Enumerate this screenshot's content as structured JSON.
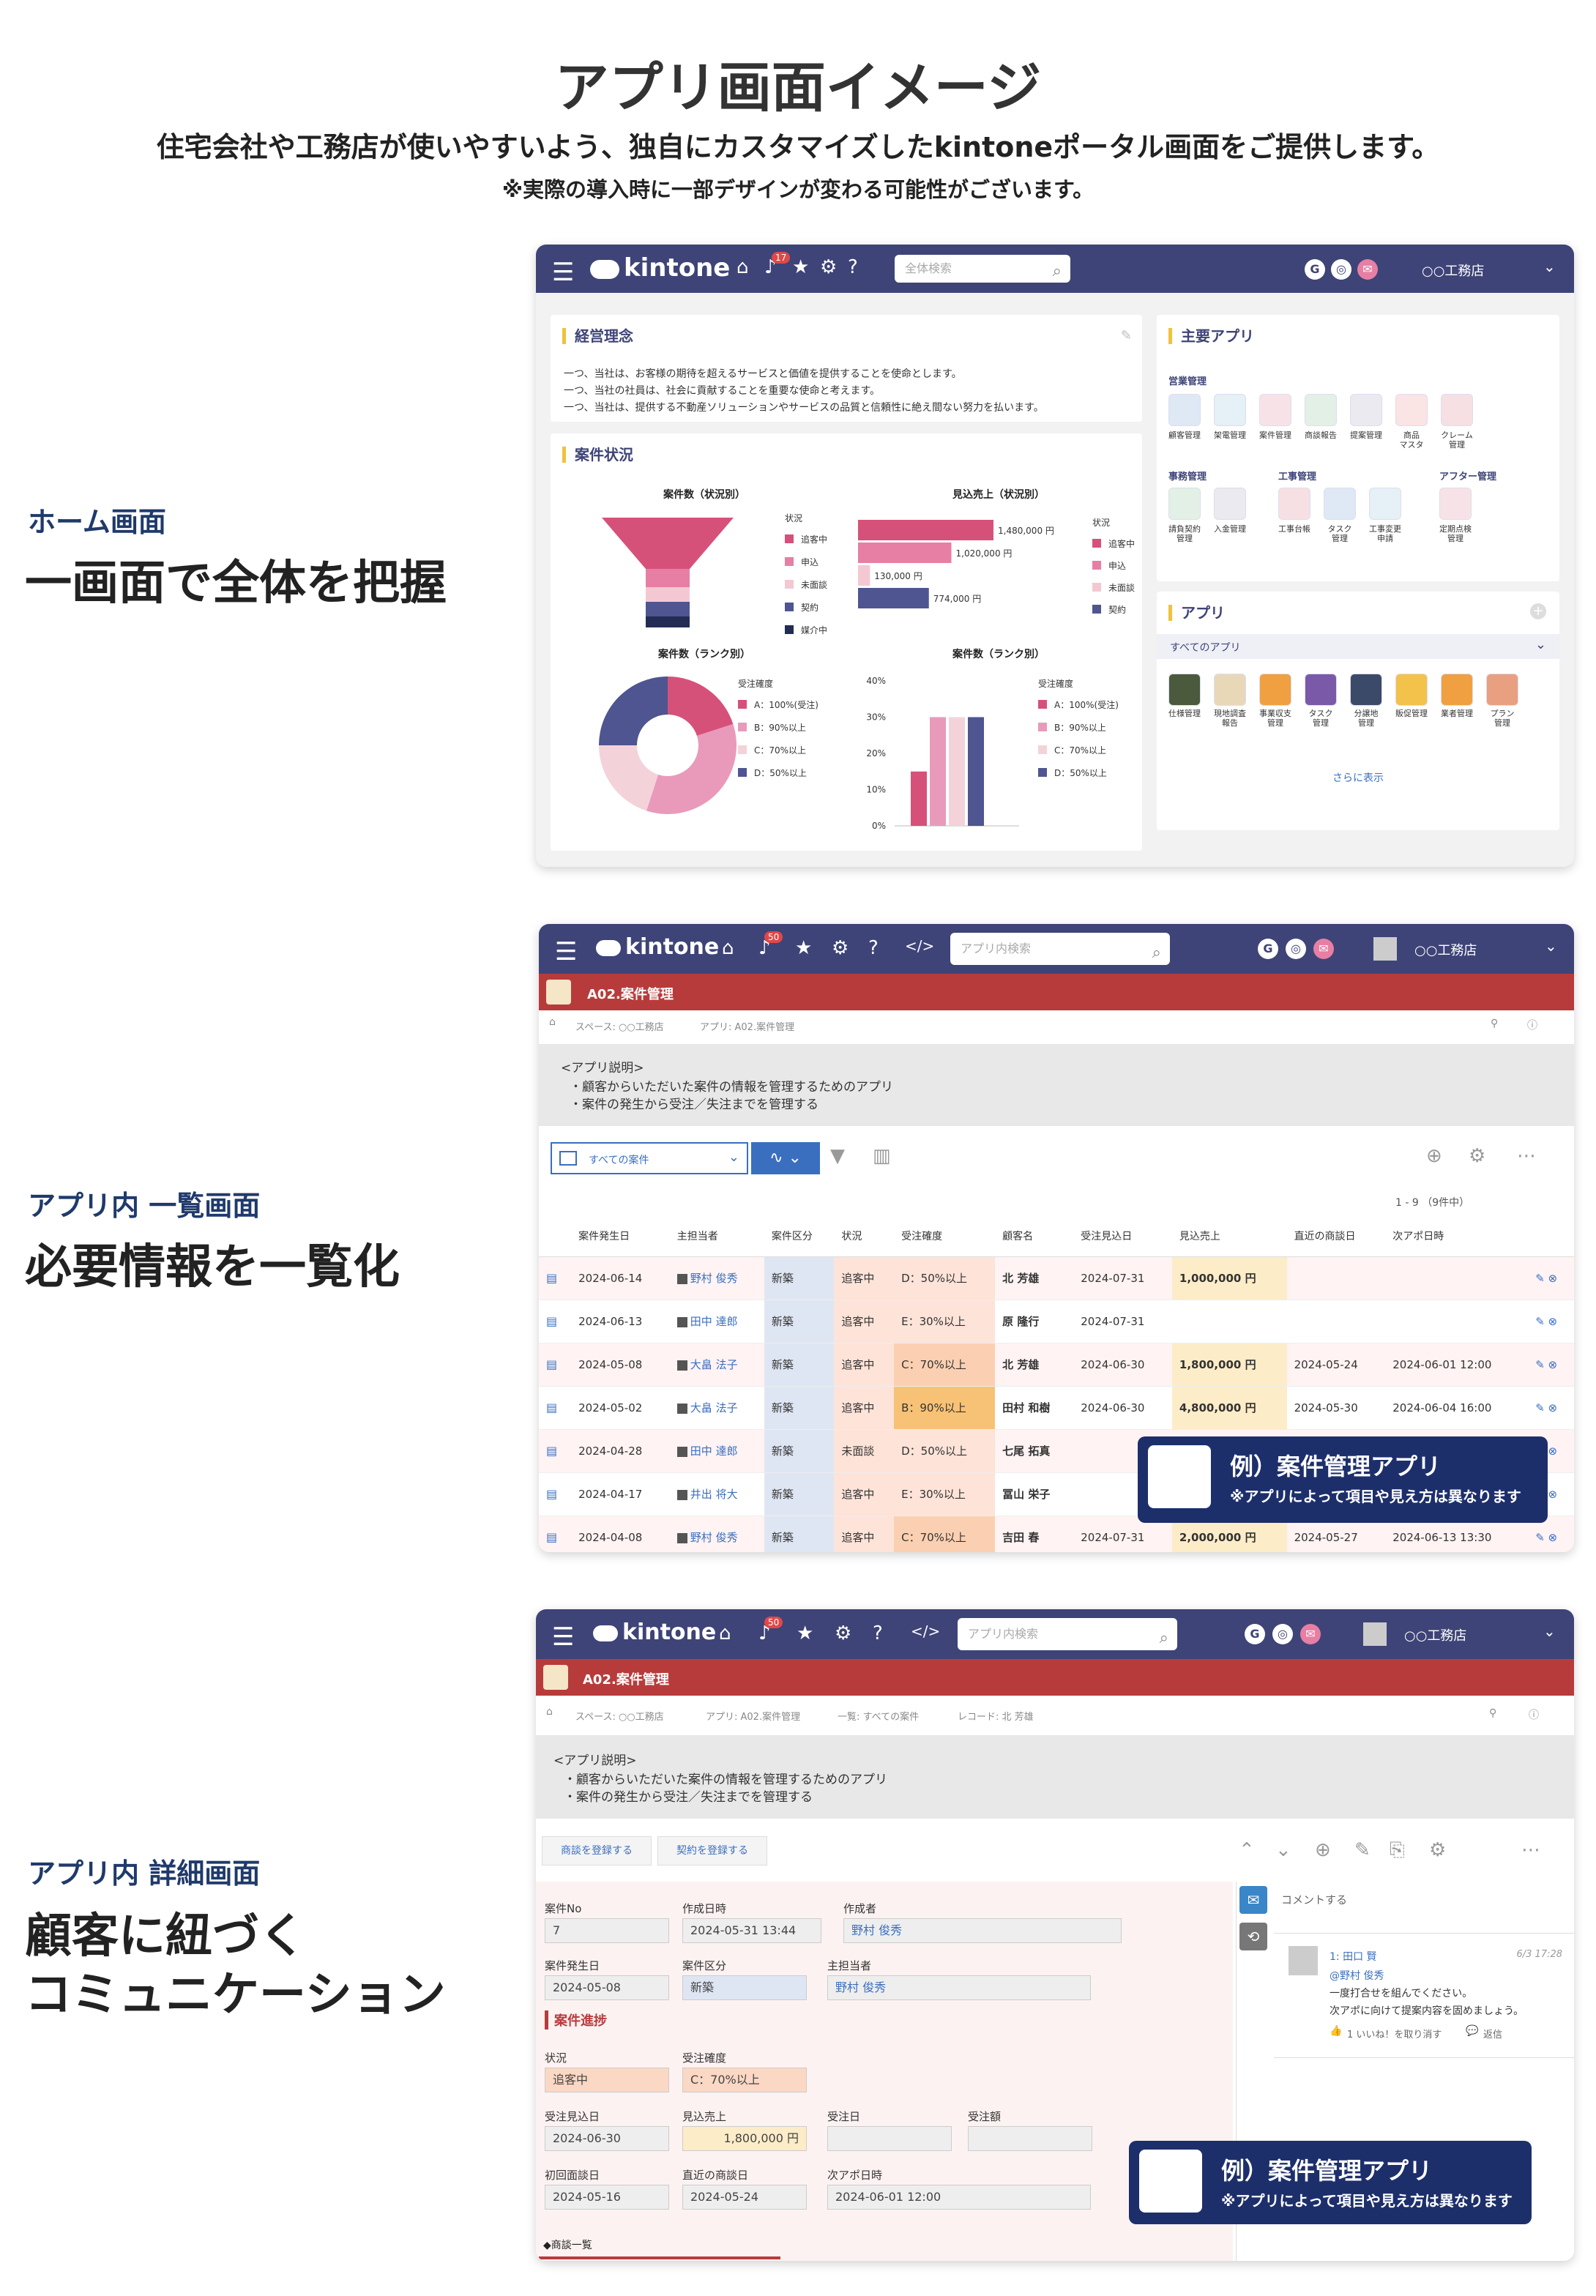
{
  "header": {
    "title": "アプリ画面イメージ",
    "subtitle": "住宅会社や工務店が使いやすいよう、独自にカスタマイズしたkintoneポータル画面をご提供します。",
    "note": "※実際の導入時に一部デザインが変わる可能性がございます。"
  },
  "sections": [
    {
      "label": "ホーム画面",
      "headline": "一画面で全体を把握"
    },
    {
      "label": "アプリ内 一覧画面",
      "headline": "必要情報を一覧化"
    },
    {
      "label": "アプリ内 詳細画面",
      "headline_line1": "顧客に紐づく",
      "headline_line2": "コミュニケーション"
    }
  ],
  "kintone": {
    "logo": "kintone",
    "badge_home": "17",
    "badge_app": "50",
    "search_home": "全体検索",
    "search_app": "アプリ内検索",
    "user": "○○工務店",
    "icons": [
      "menu-icon",
      "home-icon",
      "bell-icon",
      "star-icon",
      "gear-icon",
      "help-icon"
    ]
  },
  "home": {
    "philosophy": {
      "title": "経営理念",
      "lines": [
        "一つ、当社は、お客様の期待を超えるサービスと価値を提供することを使命とします。",
        "一つ、当社の社員は、社会に貢献することを重要な使命と考えます。",
        "一つ、当社は、提供する不動産ソリューションやサービスの品質と信頼性に絶え間ない努力を払います。"
      ]
    },
    "status_title": "案件状況",
    "main_apps": {
      "title": "主要アプリ",
      "groups": [
        {
          "name": "営業管理",
          "apps": [
            "顧客管理",
            "架電管理",
            "案件管理",
            "商談報告",
            "提案管理",
            "商品\nマスタ",
            "クレーム\n管理"
          ]
        },
        {
          "name": "事務管理",
          "apps": [
            "請負契約\n管理",
            "入金管理"
          ]
        },
        {
          "name": "工事管理",
          "apps": [
            "工事台帳",
            "タスク\n管理",
            "工事変更\n申請"
          ]
        },
        {
          "name": "アフター管理",
          "apps": [
            "定期点検\n管理"
          ]
        }
      ]
    },
    "apps": {
      "title": "アプリ",
      "filter": "すべてのアプリ",
      "list": [
        "仕様管理",
        "現地調査\n報告",
        "事業収支\n管理",
        "タスク\n管理",
        "分譲地\n管理",
        "販促管理",
        "業者管理",
        "プラン\n管理"
      ],
      "more": "さらに表示"
    }
  },
  "chart_data": [
    {
      "type": "funnel",
      "title": "案件数（状況別）",
      "legend_title": "状況",
      "categories": [
        "追客中",
        "申込",
        "未面談",
        "契約",
        "媒介中"
      ],
      "colors": [
        "#d6517a",
        "#e77fa4",
        "#f4c8d3",
        "#4e5590",
        "#232c55"
      ]
    },
    {
      "type": "bar",
      "title": "見込売上（状況別）",
      "legend_title": "状況",
      "categories": [
        "追客中",
        "申込",
        "未面談",
        "契約"
      ],
      "values": [
        1480000,
        1020000,
        130000,
        774000
      ],
      "labels": [
        "1,480,000 円",
        "1,020,000 円",
        "130,000 円",
        "774,000 円"
      ],
      "colors": [
        "#d6517a",
        "#e77fa4",
        "#f4c8d3",
        "#4e5590"
      ]
    },
    {
      "type": "pie",
      "title": "案件数（ランク別）",
      "legend_title": "受注確度",
      "categories": [
        "A：100%(受注)",
        "B：90%以上",
        "C：70%以上",
        "D：50%以上"
      ],
      "values": [
        20,
        35,
        20,
        25
      ],
      "colors": [
        "#d6517a",
        "#e99abb",
        "#f3d3d9",
        "#4e5590"
      ]
    },
    {
      "type": "bar",
      "title": "案件数（ランク別）",
      "legend_title": "受注確度",
      "categories": [
        "A：100%(受注)",
        "B：90%以上",
        "C：70%以上",
        "D：50%以上"
      ],
      "values": [
        15,
        30,
        30,
        30
      ],
      "ylim": [
        0,
        40
      ],
      "yticks": [
        "40%",
        "30%",
        "20%",
        "10%",
        "0%"
      ],
      "colors": [
        "#d6517a",
        "#e99abb",
        "#f3d3d9",
        "#4e5590"
      ]
    }
  ],
  "app": {
    "name": "A02.案件管理",
    "crumb_list": [
      "スペース: ○○工務店",
      "アプリ: A02.案件管理"
    ],
    "crumb_detail": [
      "スペース: ○○工務店",
      "アプリ: A02.案件管理",
      "一覧: すべての案件",
      "レコード: 北 芳雄"
    ],
    "desc_title": "<アプリ説明>",
    "desc_lines": [
      "・顧客からいただいた案件の情報を管理するためのアプリ",
      "・案件の発生から受注／失注までを管理する"
    ],
    "view": "すべての案件",
    "count": "1 - 9 （9件中）"
  },
  "table": {
    "headers": [
      "案件発生日",
      "主担当者",
      "案件区分",
      "状況",
      "受注確度",
      "顧客名",
      "受注見込日",
      "見込売上",
      "直近の商談日",
      "次アポ日時"
    ],
    "rows": [
      [
        "2024-06-14",
        "野村 俊秀",
        "新築",
        "追客中",
        "D：50%以上",
        "北 芳雄",
        "2024-07-31",
        "1,000,000 円",
        "",
        ""
      ],
      [
        "2024-06-13",
        "田中 達郎",
        "新築",
        "追客中",
        "E：30%以上",
        "原 隆行",
        "2024-07-31",
        "",
        "",
        ""
      ],
      [
        "2024-05-08",
        "大畠 法子",
        "新築",
        "追客中",
        "C：70%以上",
        "北 芳雄",
        "2024-06-30",
        "1,800,000 円",
        "2024-05-24",
        "2024-06-01 12:00"
      ],
      [
        "2024-05-02",
        "大畠 法子",
        "新築",
        "追客中",
        "B：90%以上",
        "田村 和樹",
        "2024-06-30",
        "4,800,000 円",
        "2024-05-30",
        "2024-06-04 16:00"
      ],
      [
        "2024-04-28",
        "田中 達郎",
        "新築",
        "未面談",
        "D：50%以上",
        "七尾 拓真",
        "",
        "",
        "",
        ""
      ],
      [
        "2024-04-17",
        "井出 将大",
        "新築",
        "追客中",
        "E：30%以上",
        "冨山 栄子",
        "",
        "",
        "",
        ""
      ],
      [
        "2024-04-08",
        "野村 俊秀",
        "新築",
        "追客中",
        "C：70%以上",
        "吉田 春",
        "2024-07-31",
        "2,000,000 円",
        "2024-05-27",
        "2024-06-13 13:30"
      ]
    ]
  },
  "callout": {
    "title": "例）案件管理アプリ",
    "note": "※アプリによって項目や見え方は異なります"
  },
  "detail": {
    "buttons": [
      "商談を登録する",
      "契約を登録する"
    ],
    "fields": [
      {
        "label": "案件No",
        "value": "7"
      },
      {
        "label": "作成日時",
        "value": "2024-05-31 13:44"
      },
      {
        "label": "作成者",
        "value": "野村 俊秀"
      },
      {
        "label": "案件発生日",
        "value": "2024-05-08"
      },
      {
        "label": "案件区分",
        "value": "新築"
      },
      {
        "label": "主担当者",
        "value": "野村 俊秀"
      },
      {
        "label": "状況",
        "value": "追客中"
      },
      {
        "label": "受注確度",
        "value": "C：70%以上"
      },
      {
        "label": "受注見込日",
        "value": "2024-06-30"
      },
      {
        "label": "見込売上",
        "value": "1,800,000 円"
      },
      {
        "label": "受注日",
        "value": ""
      },
      {
        "label": "受注額",
        "value": ""
      },
      {
        "label": "初回面談日",
        "value": "2024-05-16"
      },
      {
        "label": "直近の商談日",
        "value": "2024-05-24"
      },
      {
        "label": "次アポ日時",
        "value": "2024-06-01 12:00"
      }
    ],
    "section": "案件進捗",
    "sub_list": "◆商談一覧",
    "comment_placeholder": "コメントする",
    "comment": {
      "header": "1: 田口 賢",
      "date": "6/3 17:28",
      "mention": "@野村 俊秀",
      "text1": "一度打合せを組んでください。",
      "text2": "次アポに向けて提案内容を固めましょう。",
      "like": "1 いいね！を取り消す",
      "reply": "返信"
    }
  }
}
